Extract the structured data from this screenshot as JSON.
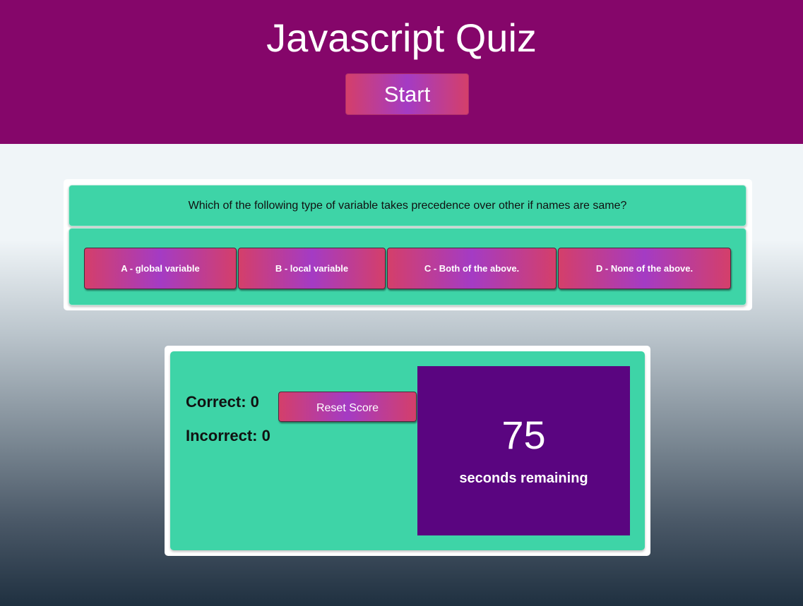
{
  "header": {
    "title": "Javascript Quiz",
    "start_label": "Start",
    "background_color": "#85066a"
  },
  "question": {
    "text": "Which of the following type of variable takes precedence over other if names are same?"
  },
  "answers": [
    {
      "label": "A - global variable"
    },
    {
      "label": "B - local variable"
    },
    {
      "label": "C - Both of the above."
    },
    {
      "label": "D - None of the above."
    }
  ],
  "score": {
    "correct_label": "Correct: 0",
    "incorrect_label": "Incorrect: 0",
    "reset_label": "Reset Score"
  },
  "timer": {
    "value": "75",
    "label": "seconds remaining",
    "background_color": "#5a0580"
  },
  "colors": {
    "panel": "#3ed4a7",
    "button_gradient": [
      "#d43f6a",
      "#a43bc4"
    ]
  }
}
